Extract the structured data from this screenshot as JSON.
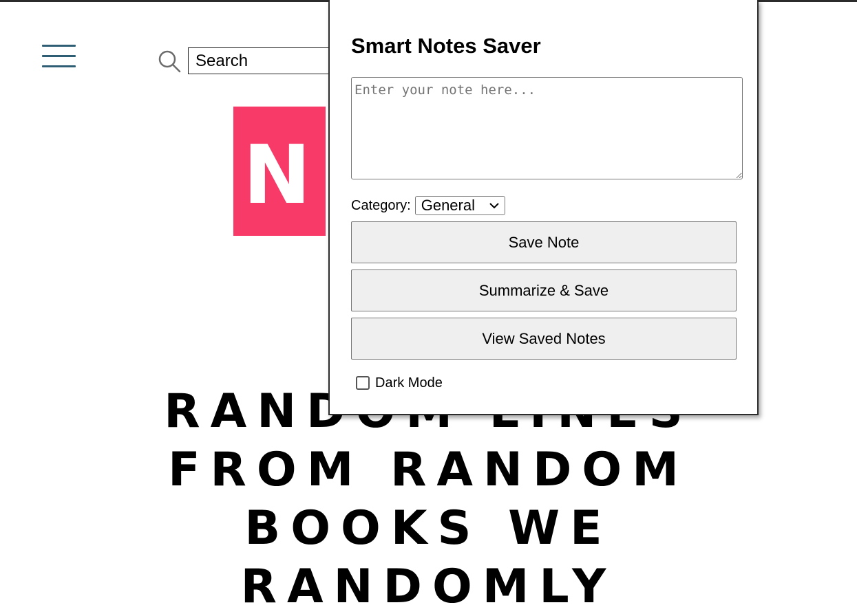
{
  "site": {
    "search": {
      "placeholder": "Search"
    },
    "logo": {
      "letter": "N",
      "color": "#f83a68"
    },
    "headline": "Random lines from random books we randomly",
    "accent_color": "#2e5e73"
  },
  "popup": {
    "title": "Smart Notes Saver",
    "note_placeholder": "Enter your note here...",
    "category_label": "Category:",
    "category_value": "General",
    "buttons": {
      "save": "Save Note",
      "summarize": "Summarize & Save",
      "view": "View Saved Notes"
    },
    "dark_mode_label": "Dark Mode",
    "dark_mode_checked": false
  },
  "icons": {
    "menu": "hamburger-menu-icon",
    "search": "search-icon",
    "dropdown": "chevron-down-icon"
  }
}
